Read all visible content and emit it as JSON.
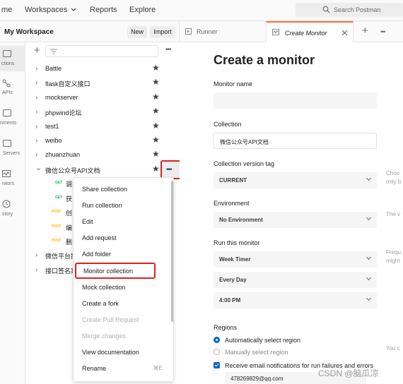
{
  "topnav": {
    "home_partial": "me",
    "workspaces": "Workspaces",
    "reports": "Reports",
    "explore": "Explore",
    "search_placeholder": "Search Postman"
  },
  "rail": {
    "collections": "ctions",
    "apis": "APIs",
    "environments": "nments",
    "mock_servers": "Servers",
    "monitors": "nitors",
    "history": "story"
  },
  "workspace": {
    "title": "My Workspace",
    "new_label": "New",
    "import_label": "Import"
  },
  "collections": [
    {
      "name": "Battle",
      "expanded": false
    },
    {
      "name": "flask自定义接口",
      "expanded": false
    },
    {
      "name": "mockserver",
      "expanded": false
    },
    {
      "name": "phpwind论坛",
      "expanded": false
    },
    {
      "name": "test1",
      "expanded": false
    },
    {
      "name": "weibo",
      "expanded": false
    },
    {
      "name": "zhuanzhuan",
      "expanded": false
    },
    {
      "name": "微信公众号API文档",
      "expanded": true
    }
  ],
  "requests": [
    {
      "method": "GET",
      "name": "调"
    },
    {
      "method": "GET",
      "name": "获"
    },
    {
      "method": "POST",
      "name": "创"
    },
    {
      "method": "POST",
      "name": "编"
    },
    {
      "method": "POST",
      "name": "删"
    }
  ],
  "more_collections": [
    {
      "name": "微信平台接"
    },
    {
      "name": "接口签名案"
    }
  ],
  "context_menu": {
    "items": [
      {
        "label": "Share collection",
        "disabled": false
      },
      {
        "label": "Run collection",
        "disabled": false
      },
      {
        "label": "Edit",
        "disabled": false
      },
      {
        "label": "Add request",
        "disabled": false
      },
      {
        "label": "Add folder",
        "disabled": false
      },
      {
        "label": "Monitor collection",
        "disabled": false,
        "highlighted": true
      },
      {
        "label": "Mock collection",
        "disabled": false
      },
      {
        "label": "Create a fork",
        "disabled": false
      },
      {
        "label": "Create Pull Request",
        "disabled": true
      },
      {
        "label": "Merge changes",
        "disabled": true
      },
      {
        "label": "View documentation",
        "disabled": false
      },
      {
        "label": "Rename",
        "disabled": false,
        "shortcut": "⌘E"
      }
    ]
  },
  "tabs": {
    "runner": "Runner",
    "create_monitor": "Create Monitor"
  },
  "form": {
    "title": "Create a monitor",
    "monitor_name_label": "Monitor name",
    "monitor_name_value": "",
    "collection_label": "Collection",
    "collection_value": "微信公众号API文档",
    "version_label": "Collection version tag",
    "version_value": "CURRENT",
    "environment_label": "Environment",
    "environment_value": "No Environment",
    "run_label": "Run this monitor",
    "timer_value": "Week Timer",
    "day_value": "Every Day",
    "time_value": "4:00 PM",
    "regions_label": "Regions",
    "region_auto": "Automatically select region",
    "region_manual": "Manually select region",
    "email_notify": "Receive email notifications for run failures and errors",
    "email_value": "478269829@qq.com"
  },
  "hints": {
    "h1a": "Choo",
    "h1b": "only b",
    "h2": "The v",
    "h3a": "Frequ",
    "h3b": "might",
    "h4": "You c"
  },
  "watermark": "CSDN @脑瓜凉",
  "colors": {
    "accent": "#ff6c37",
    "blue": "#0265d2",
    "highlight_red": "#e02020"
  }
}
